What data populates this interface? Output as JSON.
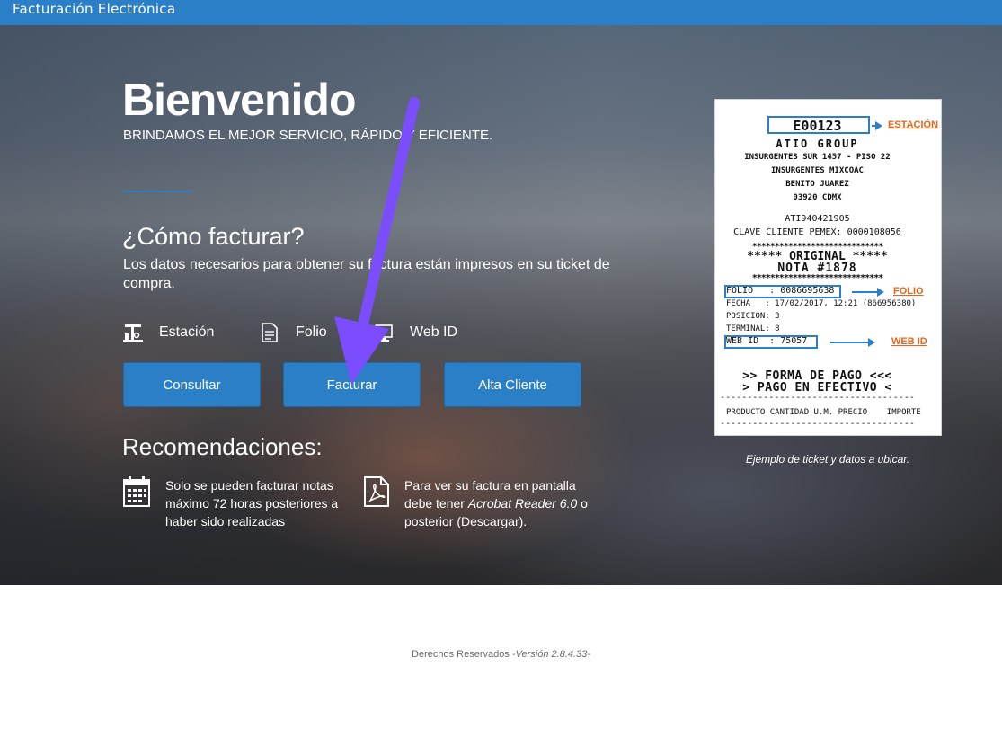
{
  "header": {
    "brand": "Facturación Electrónica"
  },
  "hero": {
    "title": "Bienvenido",
    "subtitle": "BRINDAMOS EL MEJOR SERVICIO, RÁPIDO Y EFICIENTE.",
    "how_title": "¿Cómo facturar?",
    "how_desc": "Los datos necesarios para obtener su factura están impresos en su ticket de compra."
  },
  "legend": [
    {
      "label": "Estación",
      "icon": "gas-station-icon"
    },
    {
      "label": "Folio",
      "icon": "document-icon"
    },
    {
      "label": "Web ID",
      "icon": "monitor-icon"
    }
  ],
  "buttons": {
    "consultar": "Consultar",
    "facturar": "Facturar",
    "alta_cliente": "Alta Cliente"
  },
  "recommendations": {
    "title": "Recomendaciones:",
    "items": [
      {
        "icon": "calendar-icon",
        "line1": "Solo se pueden facturar notas",
        "line2": "máximo 72 horas posteriores a",
        "line3": "haber sido realizadas"
      },
      {
        "icon": "pdf-icon",
        "line1": "Para ver su factura en pantalla",
        "line2_a": "debe tener ",
        "line2_b": "Acrobat Reader 6.0",
        "line2_c": " o",
        "line3": "posterior (Descargar)."
      }
    ]
  },
  "ticket": {
    "station_code": "E00123",
    "station_label": "ESTACIÓN",
    "company": "ATIO GROUP",
    "addr1": "INSURGENTES SUR 1457 - PISO 22",
    "addr2": "INSURGENTES MIXCOAC",
    "addr3": "BENITO JUAREZ",
    "addr4": "03920 CDMX",
    "rfc": "ATI940421905",
    "clave": "CLAVE CLIENTE PEMEX: 0000108056",
    "stars1": "*****************************",
    "original": "***** ORIGINAL *****",
    "nota": "NOTA #1878",
    "stars2": "*****************************",
    "folio": "FOLIO   : 0086695638",
    "folio_label": "FOLIO",
    "fecha": "FECHA   : 17/02/2017, 12:21 (866956380)",
    "posicion": "POSICION: 3",
    "terminal": "TERMINAL: 8",
    "webid": "WEB ID  : 75057",
    "webid_label": "WEB ID",
    "forma": ">> FORMA DE PAGO <<<",
    "pago": "> PAGO EN EFECTIVO <",
    "dashes": "------------------------------------",
    "cols": "PRODUCTO CANTIDAD U.M. PRECIO    IMPORTE",
    "caption": "Ejemplo de ticket y datos a ubicar."
  },
  "footer": {
    "text": "Derechos Reservados ",
    "version": "-Versión 2.8.4.33-"
  },
  "colors": {
    "primary": "#2a7fc6",
    "accent_arrow": "#7b4dff",
    "ticket_label": "#e8641b"
  }
}
